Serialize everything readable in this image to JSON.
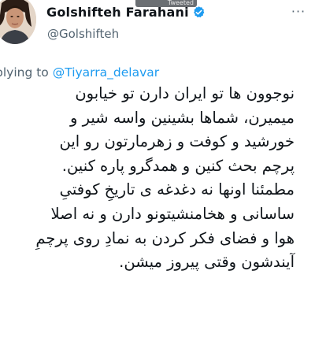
{
  "header": {
    "strip_label": "Tweeted",
    "display_name": "Golshifteh Farahani",
    "handle": "@Golshifteh",
    "more_label": "···"
  },
  "reply": {
    "prefix": "plying to ",
    "mention": "@Tiyarra_delavar"
  },
  "tweet": {
    "lines": [
      "نوجوون ها تو ایران دارن تو خیابون",
      "میمیرن، شماها بشینین واسه شیر و",
      "خورشید و کوفت و زهرمارتون رو این",
      "پرچم بحث کنین و همدگرو پاره کنین.",
      "مطمئنا اونها نه دغدغه ی تاریخِ کوفتیِ",
      "ساسانی و هخامنشیتونو دارن و نه اصلا",
      "هوا و فضای فکر کردن به نمادِ روی پرچمِ",
      "آیندشون وقتی پیروز میشن."
    ]
  },
  "icons": {
    "verified": "verified-badge-icon",
    "more": "more-options-icon",
    "avatar": "profile-avatar"
  },
  "colors": {
    "text": "#0f1419",
    "secondary": "#536471",
    "accent": "#1d9bf0"
  }
}
